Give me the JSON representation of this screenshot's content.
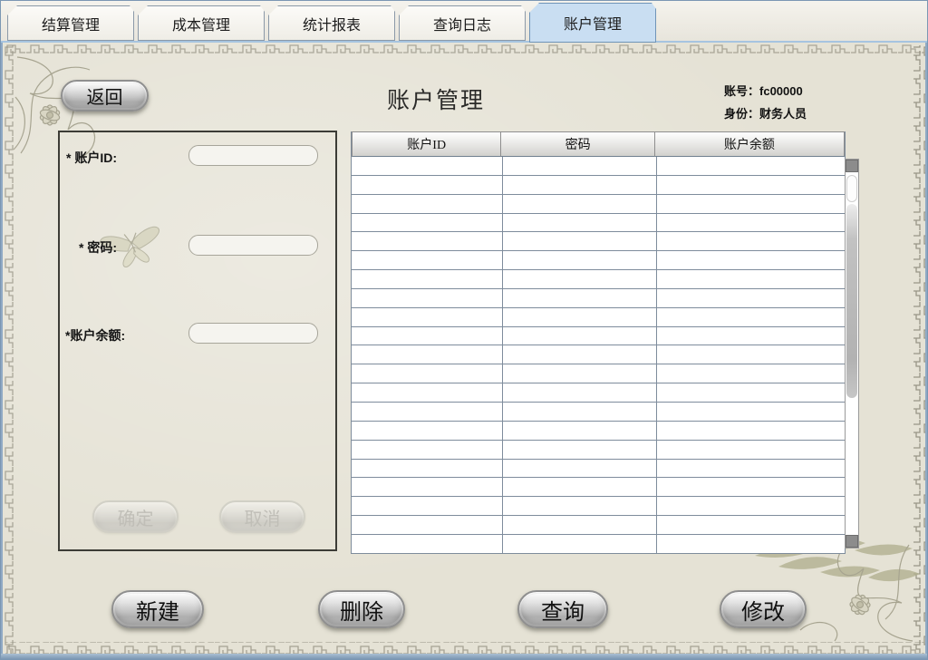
{
  "tabs": {
    "items": [
      {
        "id": "settlement",
        "label": "结算管理",
        "active": false
      },
      {
        "id": "cost",
        "label": "成本管理",
        "active": false
      },
      {
        "id": "reports",
        "label": "统计报表",
        "active": false
      },
      {
        "id": "logs",
        "label": "查询日志",
        "active": false
      },
      {
        "id": "accounts",
        "label": "账户管理",
        "active": true
      }
    ]
  },
  "header": {
    "back_label": "返回",
    "title": "账户管理",
    "account_label": "账号：",
    "account_value": "fc00000",
    "identity_label": "身份：",
    "identity_value": "财务人员"
  },
  "form": {
    "fields": [
      {
        "id": "account-id",
        "label": "* 账户ID:",
        "value": ""
      },
      {
        "id": "password",
        "label": "* 密码:",
        "value": ""
      },
      {
        "id": "balance",
        "label": "*账户余额:",
        "value": ""
      }
    ],
    "confirm_label": "确定",
    "cancel_label": "取消",
    "confirm_enabled": false,
    "cancel_enabled": false
  },
  "table": {
    "columns": [
      "账户ID",
      "密码",
      "账户余额"
    ],
    "rows": [],
    "visible_empty_rows": 21
  },
  "actions": [
    {
      "id": "new",
      "label": "新建"
    },
    {
      "id": "delete",
      "label": "删除"
    },
    {
      "id": "query",
      "label": "查询"
    },
    {
      "id": "modify",
      "label": "修改"
    }
  ],
  "icons": {
    "butterfly": "butterfly-watermark",
    "bamboo": "bamboo-watermark",
    "frame": "greek-key-ornament-border"
  },
  "colors": {
    "active_tab": "#c9def2",
    "background": "#e5e2d5",
    "table_grid": "#7e8c9c",
    "frame_blue": "#7b97b3",
    "tab_underline": "#a6c4e0"
  }
}
